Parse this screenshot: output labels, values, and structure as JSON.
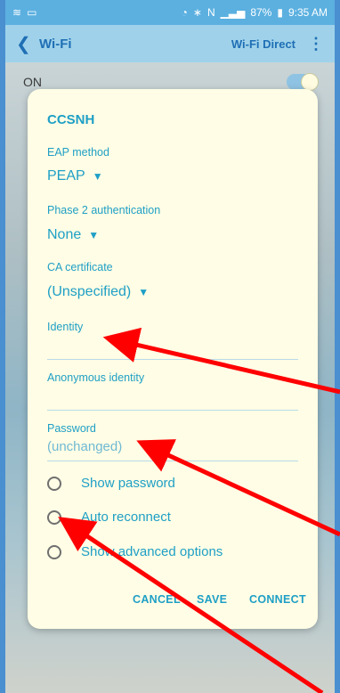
{
  "status": {
    "left_icons": [
      "wifi-icon",
      "image-icon"
    ],
    "battery": "87%",
    "time": "9:35 AM"
  },
  "appbar": {
    "title": "Wi-Fi",
    "action": "Wi-Fi Direct",
    "more_icon": "more-vert-icon"
  },
  "main": {
    "on_label": "ON"
  },
  "dialog": {
    "title": "CCSNH",
    "eap_label": "EAP method",
    "eap_value": "PEAP",
    "phase2_label": "Phase 2 authentication",
    "phase2_value": "None",
    "ca_label": "CA certificate",
    "ca_value": "(Unspecified)",
    "identity_label": "Identity",
    "identity_value": "",
    "anon_label": "Anonymous identity",
    "anon_value": "",
    "password_label": "Password",
    "password_placeholder": "(unchanged)",
    "show_password": "Show password",
    "auto_reconnect": "Auto reconnect",
    "advanced_options": "Show advanced options",
    "cancel": "CANCEL",
    "save": "SAVE",
    "connect": "CONNECT"
  },
  "colors": {
    "accent": "#1e9fc6",
    "annotation": "#ff0000"
  }
}
